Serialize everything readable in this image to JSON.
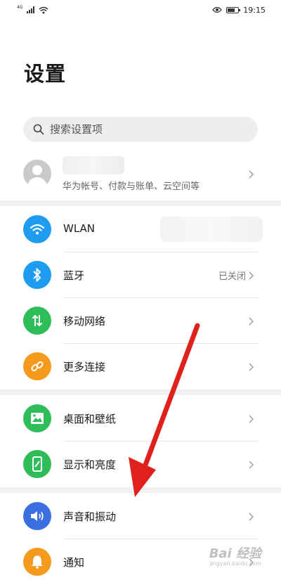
{
  "status_bar": {
    "network_tag": "4G",
    "time": "19:15"
  },
  "page": {
    "title": "设置"
  },
  "search": {
    "placeholder": "搜索设置项"
  },
  "account": {
    "subtitle": "华为帐号、付款与账单、云空间等"
  },
  "settings": [
    {
      "label": "WLAN",
      "icon": "wifi-icon",
      "color": "#1e9df0",
      "value": ""
    },
    {
      "label": "蓝牙",
      "icon": "bluetooth-icon",
      "color": "#1e9df0",
      "value": "已关闭"
    },
    {
      "label": "移动网络",
      "icon": "mobile-data-icon",
      "color": "#2fbd5a",
      "value": ""
    },
    {
      "label": "更多连接",
      "icon": "link-icon",
      "color": "#f59a1d",
      "value": ""
    },
    {
      "label": "桌面和壁纸",
      "icon": "picture-icon",
      "color": "#2fbd5a",
      "value": ""
    },
    {
      "label": "显示和亮度",
      "icon": "display-icon",
      "color": "#2fbd5a",
      "value": ""
    },
    {
      "label": "声音和振动",
      "icon": "speaker-icon",
      "color": "#3b6fe0",
      "value": ""
    },
    {
      "label": "通知",
      "icon": "bell-icon",
      "color": "#f59a1d",
      "value": ""
    }
  ],
  "watermark": {
    "main": "Bai 经验",
    "sub": "jingyan.baidu.com"
  }
}
